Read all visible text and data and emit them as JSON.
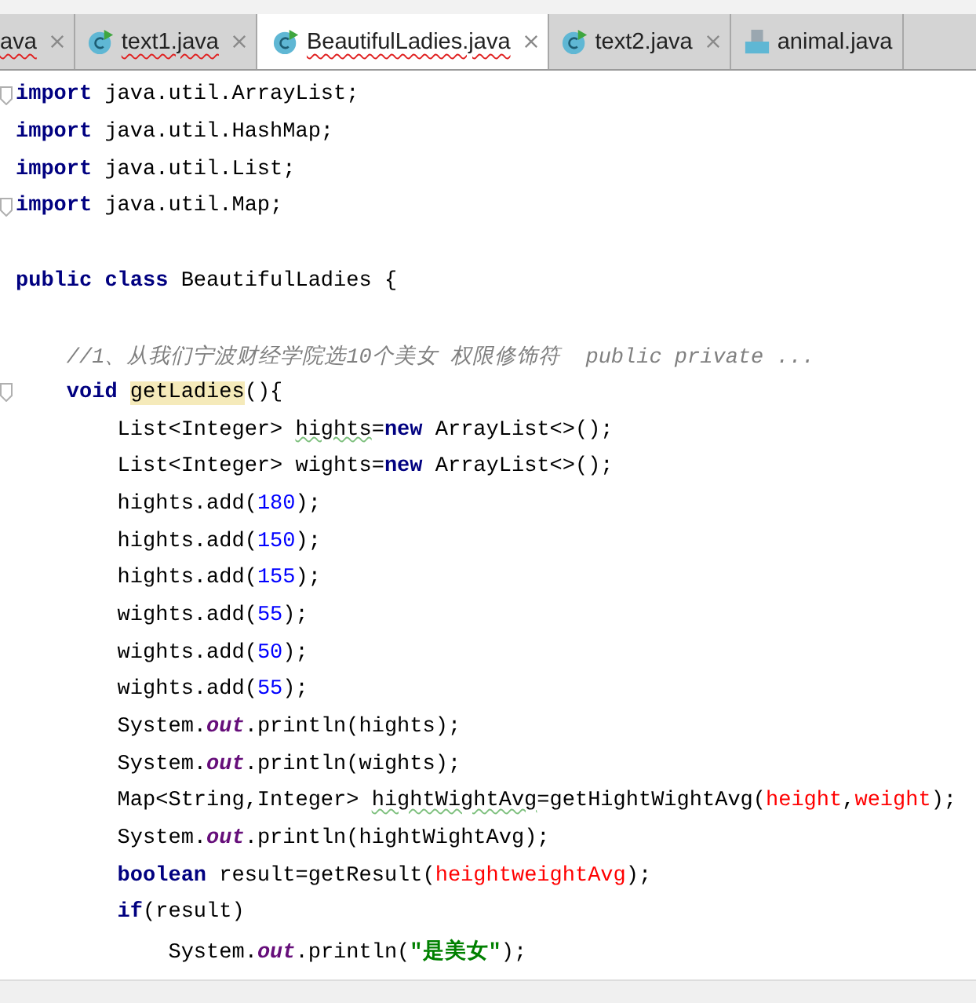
{
  "tabs": [
    {
      "label": "ava",
      "kind": "cut",
      "selected": false,
      "error": true
    },
    {
      "label": "text1.java",
      "kind": "class",
      "selected": false,
      "error": true
    },
    {
      "label": "BeautifulLadies.java",
      "kind": "class",
      "selected": true,
      "error": true
    },
    {
      "label": "text2.java",
      "kind": "class",
      "selected": false,
      "error": false
    },
    {
      "label": "animal.java",
      "kind": "file",
      "selected": false,
      "error": false
    }
  ],
  "code_lines": [
    {
      "fold": true,
      "tokens": [
        {
          "kind": "kw",
          "text": "import"
        },
        {
          "kind": "plain",
          "text": " java.util.ArrayList;"
        }
      ]
    },
    {
      "fold": false,
      "tokens": [
        {
          "kind": "kw",
          "text": "import"
        },
        {
          "kind": "plain",
          "text": " java.util.HashMap;"
        }
      ]
    },
    {
      "fold": false,
      "tokens": [
        {
          "kind": "kw",
          "text": "import"
        },
        {
          "kind": "plain",
          "text": " java.util.List;"
        }
      ]
    },
    {
      "fold": true,
      "tokens": [
        {
          "kind": "kw",
          "text": "import"
        },
        {
          "kind": "plain",
          "text": " java.util.Map;"
        }
      ]
    },
    {
      "fold": false
    },
    {
      "fold": false,
      "tokens": [
        {
          "kind": "kw",
          "text": "public class"
        },
        {
          "kind": "plain",
          "text": " BeautifulLadies {"
        }
      ]
    },
    {
      "fold": false
    },
    {
      "fold": false,
      "tokens": [
        {
          "kind": "comment",
          "text": "    //1、从我们宁波财经学院选10个美女 权限修饰符  public private ..."
        }
      ]
    },
    {
      "fold": true,
      "tokens": [
        {
          "kind": "kw",
          "text": "    void "
        },
        {
          "kind": "hl",
          "text": "getLadies"
        },
        {
          "kind": "plain",
          "text": "(){"
        }
      ]
    },
    {
      "fold": false,
      "tokens": [
        {
          "kind": "plain",
          "text": "        List<Integer> "
        },
        {
          "kind": "warn",
          "text": "hights"
        },
        {
          "kind": "plain",
          "text": "="
        },
        {
          "kind": "kw",
          "text": "new"
        },
        {
          "kind": "plain",
          "text": " ArrayList<>();"
        }
      ]
    },
    {
      "fold": false,
      "tokens": [
        {
          "kind": "plain",
          "text": "        List<Integer> wights="
        },
        {
          "kind": "kw",
          "text": "new"
        },
        {
          "kind": "plain",
          "text": " ArrayList<>();"
        }
      ]
    },
    {
      "fold": false,
      "tokens": [
        {
          "kind": "plain",
          "text": "        hights.add("
        },
        {
          "kind": "num",
          "text": "180"
        },
        {
          "kind": "plain",
          "text": ");"
        }
      ]
    },
    {
      "fold": false,
      "tokens": [
        {
          "kind": "plain",
          "text": "        hights.add("
        },
        {
          "kind": "num",
          "text": "150"
        },
        {
          "kind": "plain",
          "text": ");"
        }
      ]
    },
    {
      "fold": false,
      "tokens": [
        {
          "kind": "plain",
          "text": "        hights.add("
        },
        {
          "kind": "num",
          "text": "155"
        },
        {
          "kind": "plain",
          "text": ");"
        }
      ]
    },
    {
      "fold": false,
      "tokens": [
        {
          "kind": "plain",
          "text": "        wights.add("
        },
        {
          "kind": "num",
          "text": "55"
        },
        {
          "kind": "plain",
          "text": ");"
        }
      ]
    },
    {
      "fold": false,
      "tokens": [
        {
          "kind": "plain",
          "text": "        wights.add("
        },
        {
          "kind": "num",
          "text": "50"
        },
        {
          "kind": "plain",
          "text": ");"
        }
      ]
    },
    {
      "fold": false,
      "tokens": [
        {
          "kind": "plain",
          "text": "        wights.add("
        },
        {
          "kind": "num",
          "text": "55"
        },
        {
          "kind": "plain",
          "text": ");"
        }
      ]
    },
    {
      "fold": false,
      "tokens": [
        {
          "kind": "plain",
          "text": "        System."
        },
        {
          "kind": "field",
          "text": "out"
        },
        {
          "kind": "plain",
          "text": ".println(hights);"
        }
      ]
    },
    {
      "fold": false,
      "tokens": [
        {
          "kind": "plain",
          "text": "        System."
        },
        {
          "kind": "field",
          "text": "out"
        },
        {
          "kind": "plain",
          "text": ".println(wights);"
        }
      ]
    },
    {
      "fold": false,
      "tokens": [
        {
          "kind": "plain",
          "text": "        Map<String,Integer> "
        },
        {
          "kind": "warn",
          "text": "hightWightAvg"
        },
        {
          "kind": "plain",
          "text": "=getHightWightAvg("
        },
        {
          "kind": "err",
          "text": "height"
        },
        {
          "kind": "plain",
          "text": ","
        },
        {
          "kind": "err",
          "text": "weight"
        },
        {
          "kind": "plain",
          "text": ");"
        }
      ]
    },
    {
      "fold": false,
      "tokens": [
        {
          "kind": "plain",
          "text": "        System."
        },
        {
          "kind": "field",
          "text": "out"
        },
        {
          "kind": "plain",
          "text": ".println(hightWightAvg);"
        }
      ]
    },
    {
      "fold": false,
      "tokens": [
        {
          "kind": "kw",
          "text": "        boolean"
        },
        {
          "kind": "plain",
          "text": " result=getResult("
        },
        {
          "kind": "err",
          "text": "heightweightAvg"
        },
        {
          "kind": "plain",
          "text": ");"
        }
      ]
    },
    {
      "fold": false,
      "tokens": [
        {
          "kind": "kw",
          "text": "        if"
        },
        {
          "kind": "plain",
          "text": "(result)"
        }
      ]
    },
    {
      "fold": false,
      "tokens": [
        {
          "kind": "plain",
          "text": "            System."
        },
        {
          "kind": "field",
          "text": "out"
        },
        {
          "kind": "plain",
          "text": ".println("
        },
        {
          "kind": "str",
          "text": "\"是美女\""
        },
        {
          "kind": "plain",
          "text": ");"
        }
      ]
    }
  ]
}
